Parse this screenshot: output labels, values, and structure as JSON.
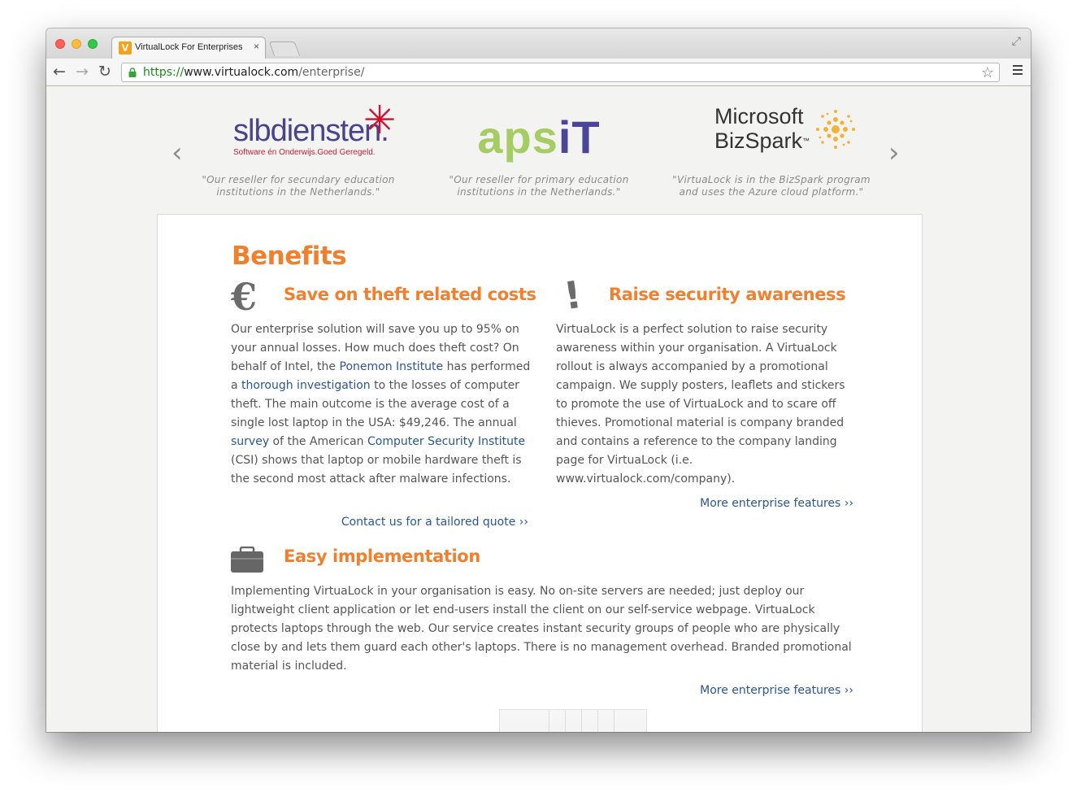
{
  "browser": {
    "tab_title": "VirtualLock For Enterprises",
    "tab_favicon": "V",
    "tab_close": "×",
    "url_scheme": "https://",
    "url_host": "www.virtualock.com",
    "url_path": "/enterprise/",
    "nav_back": "←",
    "nav_forward": "→",
    "nav_reload": "↻",
    "star": "☆",
    "fullscreen": "⤢"
  },
  "carousel": {
    "prev": "‹",
    "next": "›",
    "partners": [
      {
        "name": "slbdiensten.",
        "tagline": "Software én Onderwijs.Goed Geregeld.",
        "quote": "\"Our reseller for secundary education institutions in the Netherlands.\""
      },
      {
        "name_part1": "aps",
        "name_part2": "iT",
        "quote": "\"Our reseller for primary education institutions in the Netherlands.\""
      },
      {
        "name_line1": "Microsoft",
        "name_line2": "BizSpark",
        "trademark": "™",
        "quote": "\"VirtuaLock is in the BizSpark program and uses the Azure cloud platform.\""
      }
    ]
  },
  "benefits": {
    "heading": "Benefits",
    "theft": {
      "icon": "€",
      "title": "Save on theft related costs",
      "text_1": "Our enterprise solution will save you up to 95% on your annual losses. How much does theft cost? On behalf of Intel, the ",
      "link_1": "Ponemon Institute",
      "text_2": " has performed a ",
      "link_2": "thorough investigation",
      "text_3": " to the losses of computer theft. The main outcome is the average cost of a single lost laptop in the USA: $49,246. The annual ",
      "link_3": "survey",
      "text_4": " of the American ",
      "link_4": "Computer Security Institute",
      "text_5": " (CSI) shows that laptop or mobile hardware theft is the second most attack after malware infections.",
      "cta": "Contact us for a tailored quote ››"
    },
    "awareness": {
      "icon": "!",
      "title": "Raise security awareness",
      "text": "VirtuaLock is a perfect solution to raise security awareness within your organisation. A VirtuaLock rollout is always accompanied by a promotional campaign. We supply posters, leaflets and stickers to promote the use of VirtuaLock and to scare off thieves. Promotional material is company branded and contains a reference to the company landing page for VirtuaLock (i.e. www.virtualock.com/company).",
      "cta": "More enterprise features ››"
    },
    "implementation": {
      "title": "Easy implementation",
      "text": "Implementing VirtuaLock in your organisation is easy. No on-site servers are needed; just deploy our lightweight client application or let end-users install the client on our self-service webpage. VirtuaLock protects laptops through the web. Our service creates instant security groups of people who are physically close by and lets them guard each other's laptops. There is no management overhead. Branded promotional material is included.",
      "cta": "More enterprise features ››"
    }
  },
  "colors": {
    "accent": "#f07f2e",
    "link": "#2a5597",
    "body_text": "#555555"
  }
}
